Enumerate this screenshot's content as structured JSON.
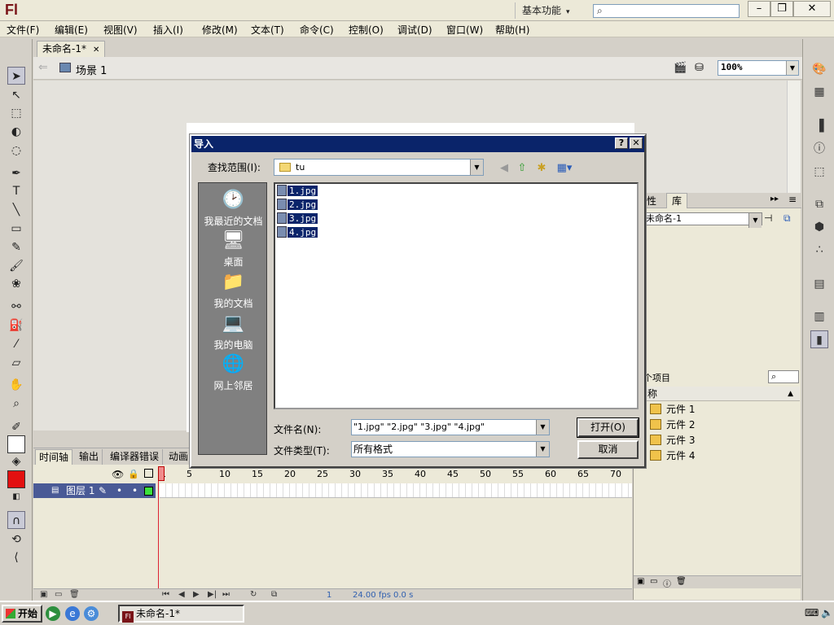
{
  "app": {
    "logo": "Fl",
    "workspace": "基本功能",
    "search_placeholder": ""
  },
  "menubar": {
    "items": [
      "文件(F)",
      "编辑(E)",
      "视图(V)",
      "插入(I)",
      "修改(M)",
      "文本(T)",
      "命令(C)",
      "控制(O)",
      "调试(D)",
      "窗口(W)",
      "帮助(H)"
    ]
  },
  "document": {
    "tab_title": "未命名-1*",
    "scene_label": "场景 1",
    "zoom": "100%"
  },
  "right_panel": {
    "tab_properties": "性",
    "tab_library": "库",
    "library_document": "未命名-1",
    "items_count": "个项目",
    "column_name": "称",
    "items": [
      "元件 1",
      "元件 2",
      "元件 3",
      "元件 4"
    ]
  },
  "timeline": {
    "tabs": [
      "时间轴",
      "输出",
      "编译器错误",
      "动画"
    ],
    "frame_numbers": [
      "1",
      "5",
      "10",
      "15",
      "20",
      "25",
      "30",
      "35",
      "40",
      "45",
      "50",
      "55",
      "60",
      "65",
      "70"
    ],
    "layer_name": "图层 1",
    "current_frame": "1",
    "fps": "24.00",
    "fps_unit": "fps",
    "elapsed": "0.0",
    "elapsed_unit": "s"
  },
  "dialog": {
    "title": "导入",
    "help_btn": "?",
    "close_btn": "✕",
    "lookin_label": "查找范围(I):",
    "lookin_value": "tu",
    "places": [
      "我最近的文档",
      "桌面",
      "我的文档",
      "我的电脑",
      "网上邻居"
    ],
    "files": [
      "1.jpg",
      "2.jpg",
      "3.jpg",
      "4.jpg"
    ],
    "filename_label": "文件名(N):",
    "filename_value": "\"1.jpg\" \"2.jpg\" \"3.jpg\" \"4.jpg\"",
    "filetype_label": "文件类型(T):",
    "filetype_value": "所有格式",
    "open_btn": "打开(O)",
    "cancel_btn": "取消"
  },
  "taskbar": {
    "start": "开始",
    "task_item": "未命名-1*",
    "task_icon": "Fl"
  }
}
